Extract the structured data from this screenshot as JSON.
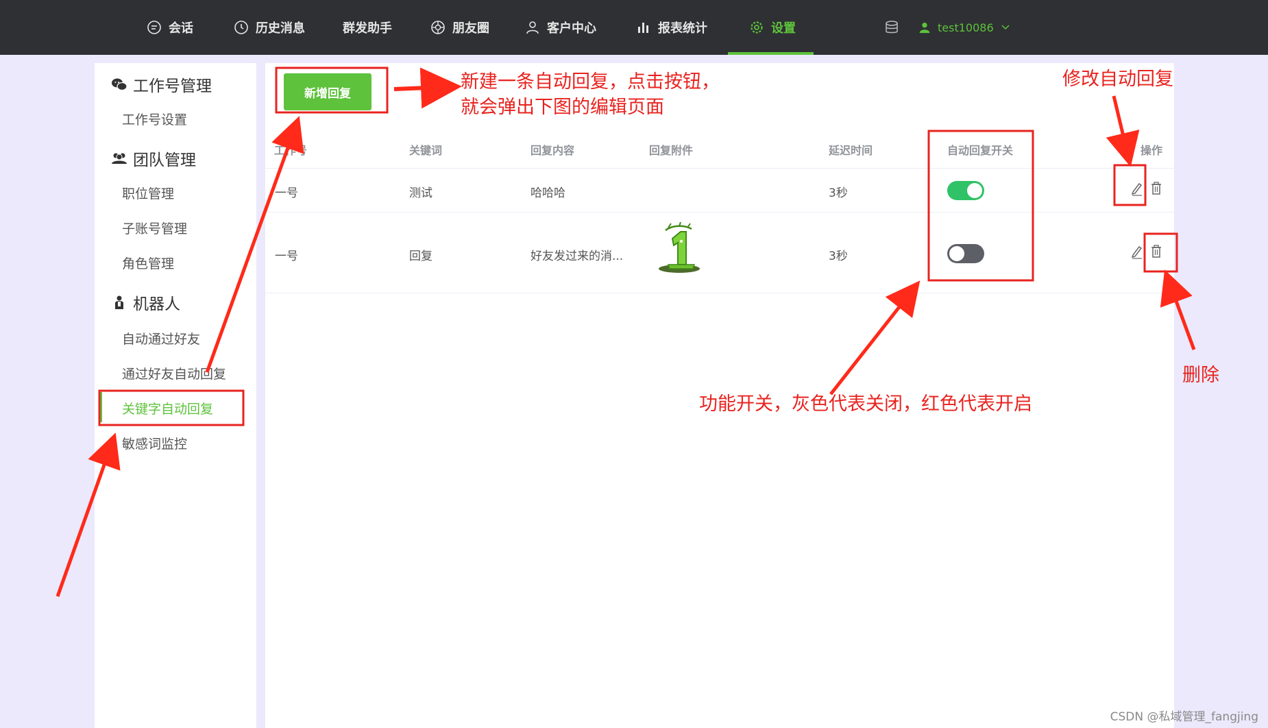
{
  "nav": {
    "items": [
      {
        "label": "会话",
        "icon": "chat-icon"
      },
      {
        "label": "历史消息",
        "icon": "clock-icon"
      },
      {
        "label": "群发助手",
        "icon": ""
      },
      {
        "label": "朋友圈",
        "icon": "aperture-icon"
      },
      {
        "label": "客户中心",
        "icon": "user-icon"
      },
      {
        "label": "报表统计",
        "icon": "bar-chart-icon"
      },
      {
        "label": "设置",
        "icon": "gear-icon",
        "active": true
      }
    ],
    "db_icon": "database-icon",
    "username": "test10086"
  },
  "sidebar": {
    "groups": [
      {
        "title": "工作号管理",
        "icon": "wechat-icon",
        "items": [
          "工作号设置"
        ]
      },
      {
        "title": "团队管理",
        "icon": "team-icon",
        "items": [
          "职位管理",
          "子账号管理",
          "角色管理"
        ]
      },
      {
        "title": "机器人",
        "icon": "robot-icon",
        "items": [
          "自动通过好友",
          "通过好友自动回复",
          "关键字自动回复",
          "敏感词监控"
        ]
      }
    ],
    "active_item": "关键字自动回复"
  },
  "main": {
    "add_button": "新增回复",
    "columns": [
      "工作号",
      "关键词",
      "回复内容",
      "回复附件",
      "延迟时间",
      "自动回复开关",
      "操作"
    ],
    "rows": [
      {
        "account": "一号",
        "keyword": "测试",
        "content": "哈哈哈",
        "attachment": "",
        "delay": "3秒",
        "enabled": true
      },
      {
        "account": "一号",
        "keyword": "回复",
        "content": "好友发过来的消...",
        "attachment": "green-number-one-image",
        "delay": "3秒",
        "enabled": false
      }
    ]
  },
  "annotations": {
    "new_reply_line1": "新建一条自动回复，点击按钮，",
    "new_reply_line2": "就会弹出下图的编辑页面",
    "edit_reply": "修改自动回复",
    "delete": "删除",
    "switch_note": "功能开关，灰色代表关闭，红色代表开启"
  },
  "watermark": "CSDN @私域管理_fangjing",
  "colors": {
    "nav_bg": "#2e3033",
    "accent_green": "#5ec23c",
    "toggle_on": "#2fc266",
    "toggle_off": "#5d5f66",
    "annotation_red": "#e8231f",
    "page_bg": "#ebe9fb"
  }
}
